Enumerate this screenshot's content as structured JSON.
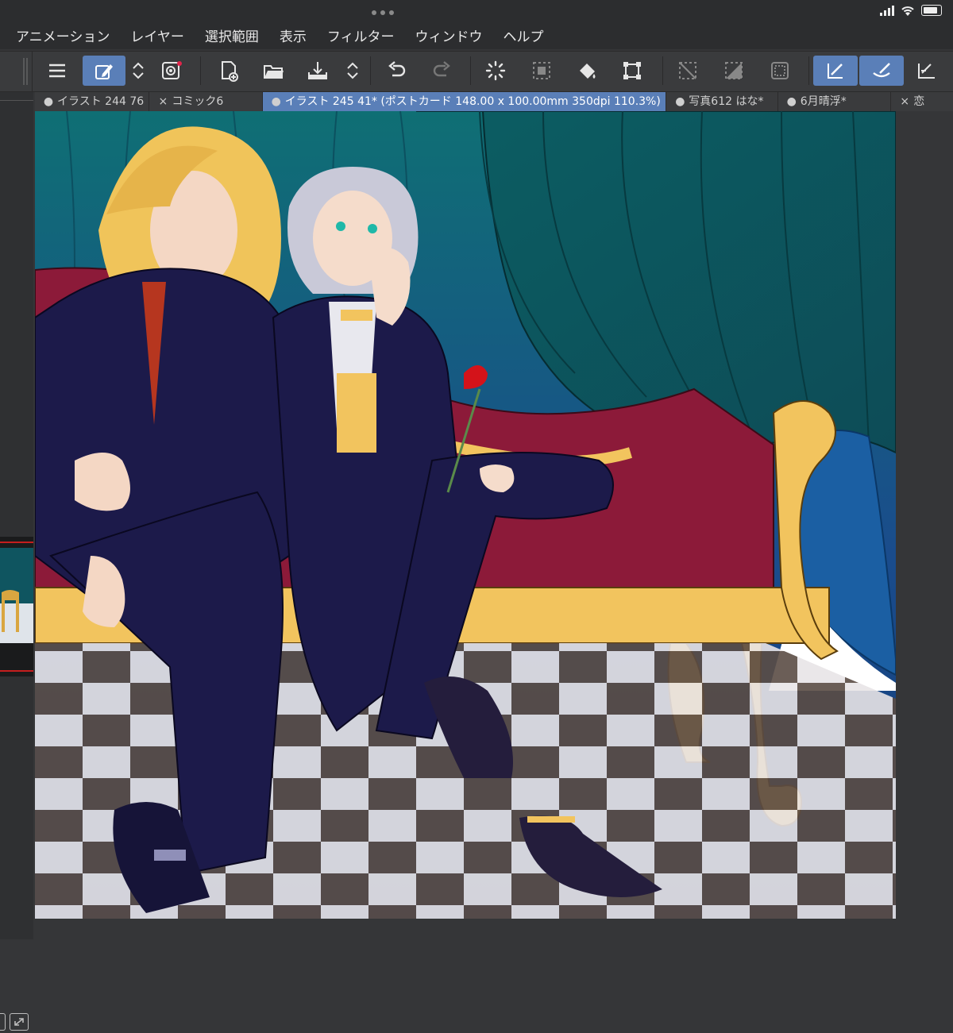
{
  "menubar": {
    "items": [
      "アニメーション",
      "レイヤー",
      "選択範囲",
      "表示",
      "フィルター",
      "ウィンドウ",
      "ヘルプ"
    ]
  },
  "toolbar": {
    "icons": [
      "hamburger-menu-icon",
      "edit-pen-icon",
      "up-down-chevron-icon",
      "spiral-icon",
      "new-canvas-icon",
      "open-folder-icon",
      "save-tray-icon",
      "up-down-chevron-icon",
      "undo-icon",
      "redo-icon",
      "spinner-icon",
      "selection-dots-icon",
      "fill-bucket-icon",
      "transform-icon",
      "deselect-icon",
      "invert-selection-icon",
      "select-border-icon",
      "ruler-pen-icon",
      "ruler-brush-icon",
      "ruler-icon"
    ]
  },
  "tabs": [
    {
      "mark": "●",
      "label": "イラスト 244 76"
    },
    {
      "mark": "×",
      "label": "コミック6"
    },
    {
      "mark": "●",
      "label": "イラスト 245 41* (ポストカード 148.00 x 100.00mm 350dpi 110.3%)"
    },
    {
      "mark": "●",
      "label": "写真612 はな*"
    },
    {
      "mark": "●",
      "label": "6月晴浮*"
    },
    {
      "mark": "×",
      "label": "恋"
    }
  ],
  "colors": {
    "accent": "#5a7fb8",
    "background": "#353638",
    "curtain": "#0f5560",
    "sofa_red": "#8c1a39",
    "gold": "#f2c45e"
  }
}
